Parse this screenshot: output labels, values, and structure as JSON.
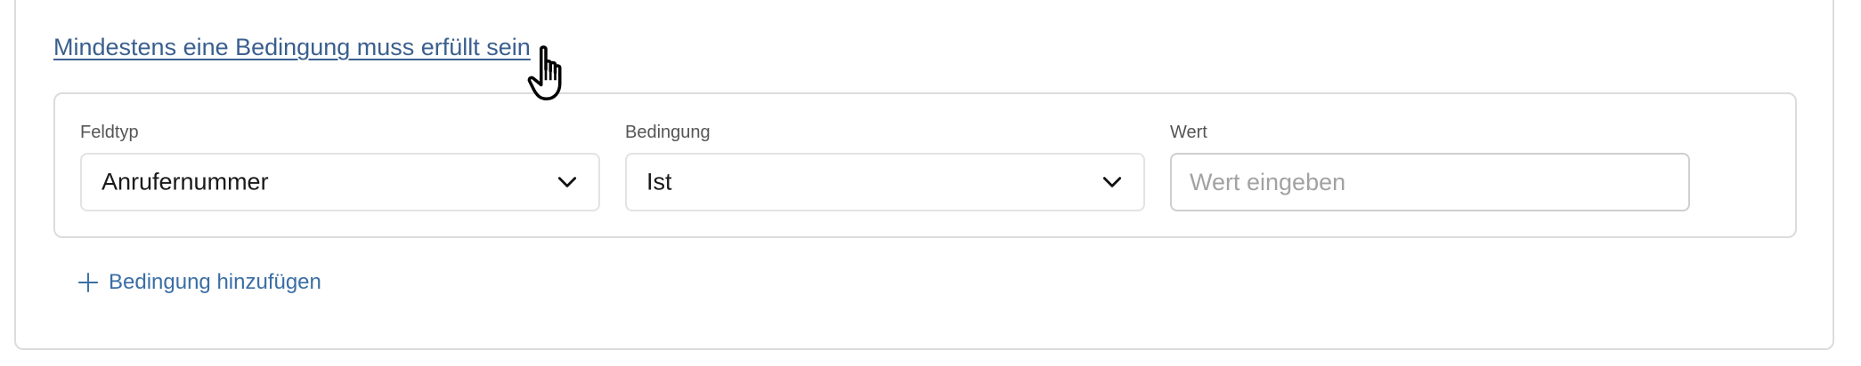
{
  "match_rule": {
    "link_text": "Mindestens eine Bedingung muss erfüllt sein"
  },
  "condition": {
    "field_type": {
      "label": "Feldtyp",
      "value": "Anrufernummer"
    },
    "operator": {
      "label": "Bedingung",
      "value": "Ist"
    },
    "value": {
      "label": "Wert",
      "current_value": "",
      "placeholder": "Wert eingeben"
    }
  },
  "add_condition": {
    "label": "Bedingung hinzufügen",
    "icon": "plus-icon"
  },
  "icons": {
    "select_chevron": "chevron-down-icon",
    "cursor": "hand-pointer-cursor-icon"
  },
  "colors": {
    "link": "#3a5f8f",
    "accent": "#3a6ea5",
    "border": "#dcdcdc",
    "placeholder": "#a2a2a2"
  }
}
